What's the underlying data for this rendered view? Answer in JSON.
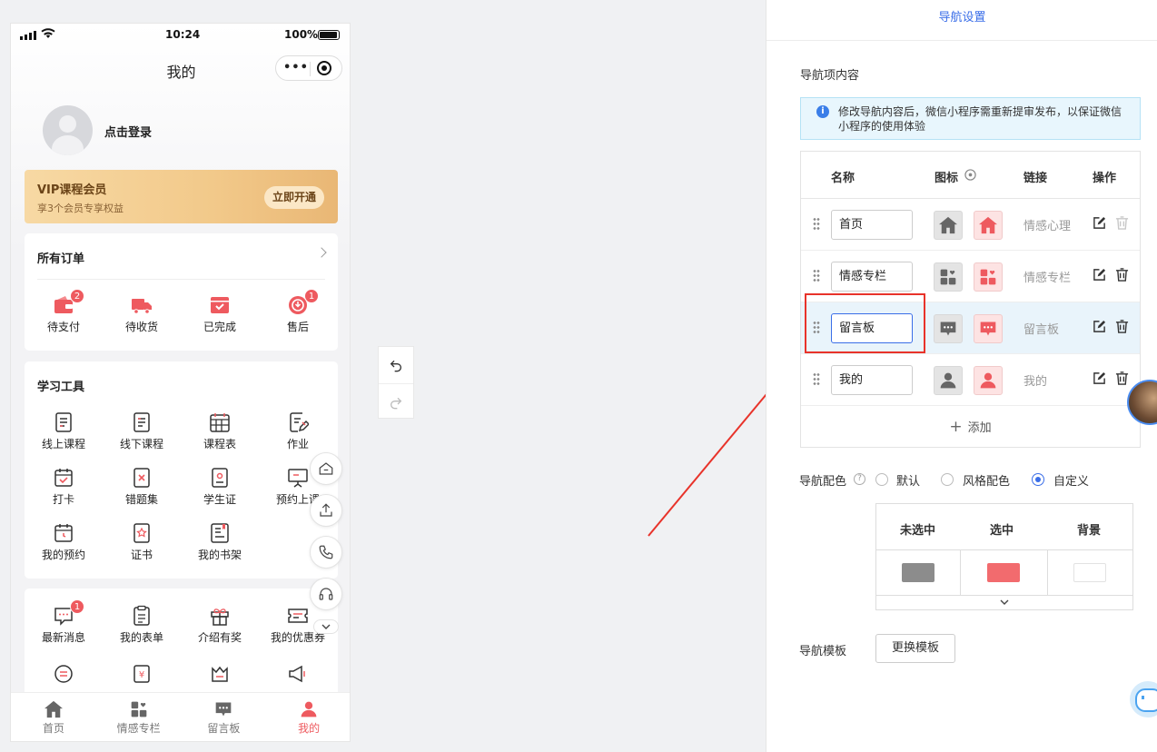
{
  "phone": {
    "status": {
      "time": "10:24",
      "battery": "100%"
    },
    "title": "我的",
    "login_text": "点击登录",
    "vip": {
      "title": "VIP课程会员",
      "subtitle": "享3个会员专享权益",
      "button": "立即开通"
    },
    "orders": {
      "title": "所有订单",
      "items": [
        {
          "label": "待支付",
          "badge": "2",
          "icon": "wallet-icon"
        },
        {
          "label": "待收货",
          "badge": "",
          "icon": "truck-icon"
        },
        {
          "label": "已完成",
          "badge": "",
          "icon": "box-check-icon"
        },
        {
          "label": "售后",
          "badge": "1",
          "icon": "refund-icon"
        }
      ]
    },
    "tools": {
      "title": "学习工具",
      "items": [
        {
          "label": "线上课程",
          "icon": "document-icon"
        },
        {
          "label": "线下课程",
          "icon": "document-icon"
        },
        {
          "label": "课程表",
          "icon": "calendar-grid-icon"
        },
        {
          "label": "作业",
          "icon": "edit-note-icon"
        },
        {
          "label": "打卡",
          "icon": "calendar-check-icon"
        },
        {
          "label": "错题集",
          "icon": "wrong-book-icon"
        },
        {
          "label": "学生证",
          "icon": "id-card-icon"
        },
        {
          "label": "预约上课",
          "icon": "presentation-icon"
        },
        {
          "label": "我的预约",
          "icon": "calendar-clock-icon"
        },
        {
          "label": "证书",
          "icon": "certificate-icon"
        },
        {
          "label": "我的书架",
          "icon": "bookshelf-icon"
        }
      ]
    },
    "more": {
      "items": [
        {
          "label": "最新消息",
          "badge": "1",
          "icon": "message-icon"
        },
        {
          "label": "我的表单",
          "badge": "",
          "icon": "clipboard-icon"
        },
        {
          "label": "介绍有奖",
          "badge": "",
          "icon": "gift-icon"
        },
        {
          "label": "我的优惠券",
          "badge": "",
          "icon": "coupon-icon"
        }
      ]
    },
    "tabbar": [
      {
        "label": "首页",
        "icon": "home-icon",
        "active": false
      },
      {
        "label": "情感专栏",
        "icon": "category-icon",
        "active": false
      },
      {
        "label": "留言板",
        "icon": "chat-icon",
        "active": false
      },
      {
        "label": "我的",
        "icon": "user-icon",
        "active": true
      }
    ]
  },
  "panel": {
    "header": "导航设置",
    "nav_content_label": "导航项内容",
    "notice": "修改导航内容后，微信小程序需重新提审发布，以保证微信小程序的使用体验",
    "table_headers": {
      "name": "名称",
      "icon": "图标",
      "link": "链接",
      "action": "操作"
    },
    "rows": [
      {
        "name": "首页",
        "link": "情感心理",
        "icon": "home-icon"
      },
      {
        "name": "情感专栏",
        "link": "情感专栏",
        "icon": "category-icon"
      },
      {
        "name": "留言板",
        "link": "留言板",
        "icon": "chat-icon"
      },
      {
        "name": "我的",
        "link": "我的",
        "icon": "user-icon"
      }
    ],
    "add_label": "添加",
    "color_label": "导航配色",
    "color_options": [
      "默认",
      "风格配色",
      "自定义"
    ],
    "color_selected": "自定义",
    "color_table_headers": [
      "未选中",
      "选中",
      "背景"
    ],
    "colors": {
      "unselected": "#8c8c8c",
      "selected": "#f26b6e",
      "background": "#ffffff"
    },
    "template_label": "导航模板",
    "template_button": "更换模板"
  },
  "accent": "#3a6ee8",
  "brand_red": "#ee5a5f"
}
